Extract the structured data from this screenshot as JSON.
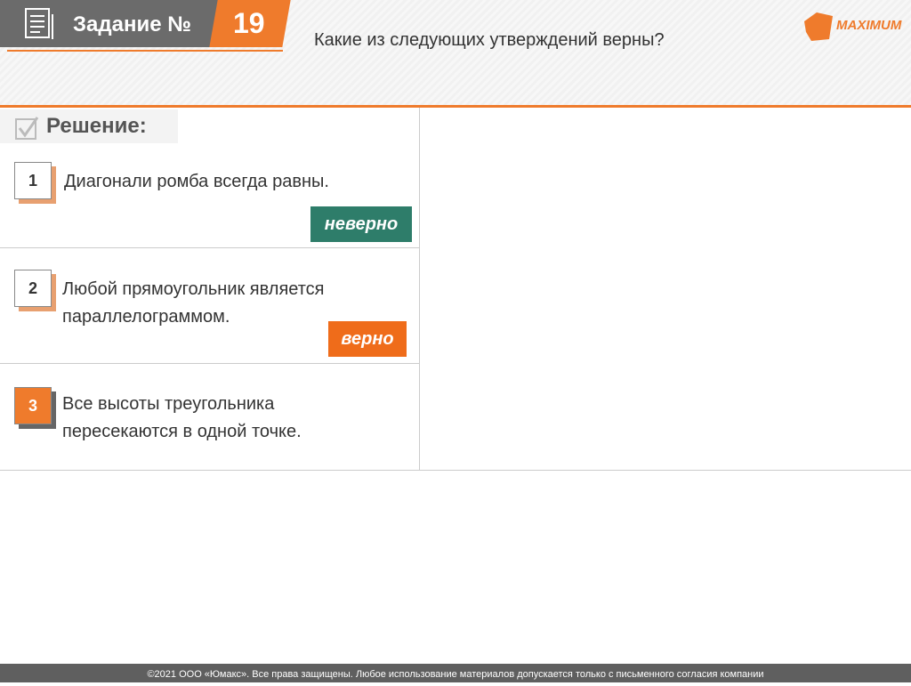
{
  "header": {
    "title": "Задание №",
    "number": "19",
    "question": "Какие из следующих утверждений верны?",
    "logo": "MAXIMUM"
  },
  "solution": {
    "label": "Решение:"
  },
  "items": [
    {
      "n": "1",
      "text": "Диагонали ромба всегда равны.",
      "answer": "неверно"
    },
    {
      "n": "2",
      "text": "Любой прямоугольник является параллелограммом.",
      "answer": "верно"
    },
    {
      "n": "3",
      "text": "Все высоты треугольника пересекаются в одной точке."
    }
  ],
  "colors": {
    "accent": "#ef7b2c",
    "wrong": "#2e7d6a"
  },
  "footer": "©2021 ООО «Юмакс». Все права защищены. Любое использование материалов допускается только с  письменного согласия компании"
}
